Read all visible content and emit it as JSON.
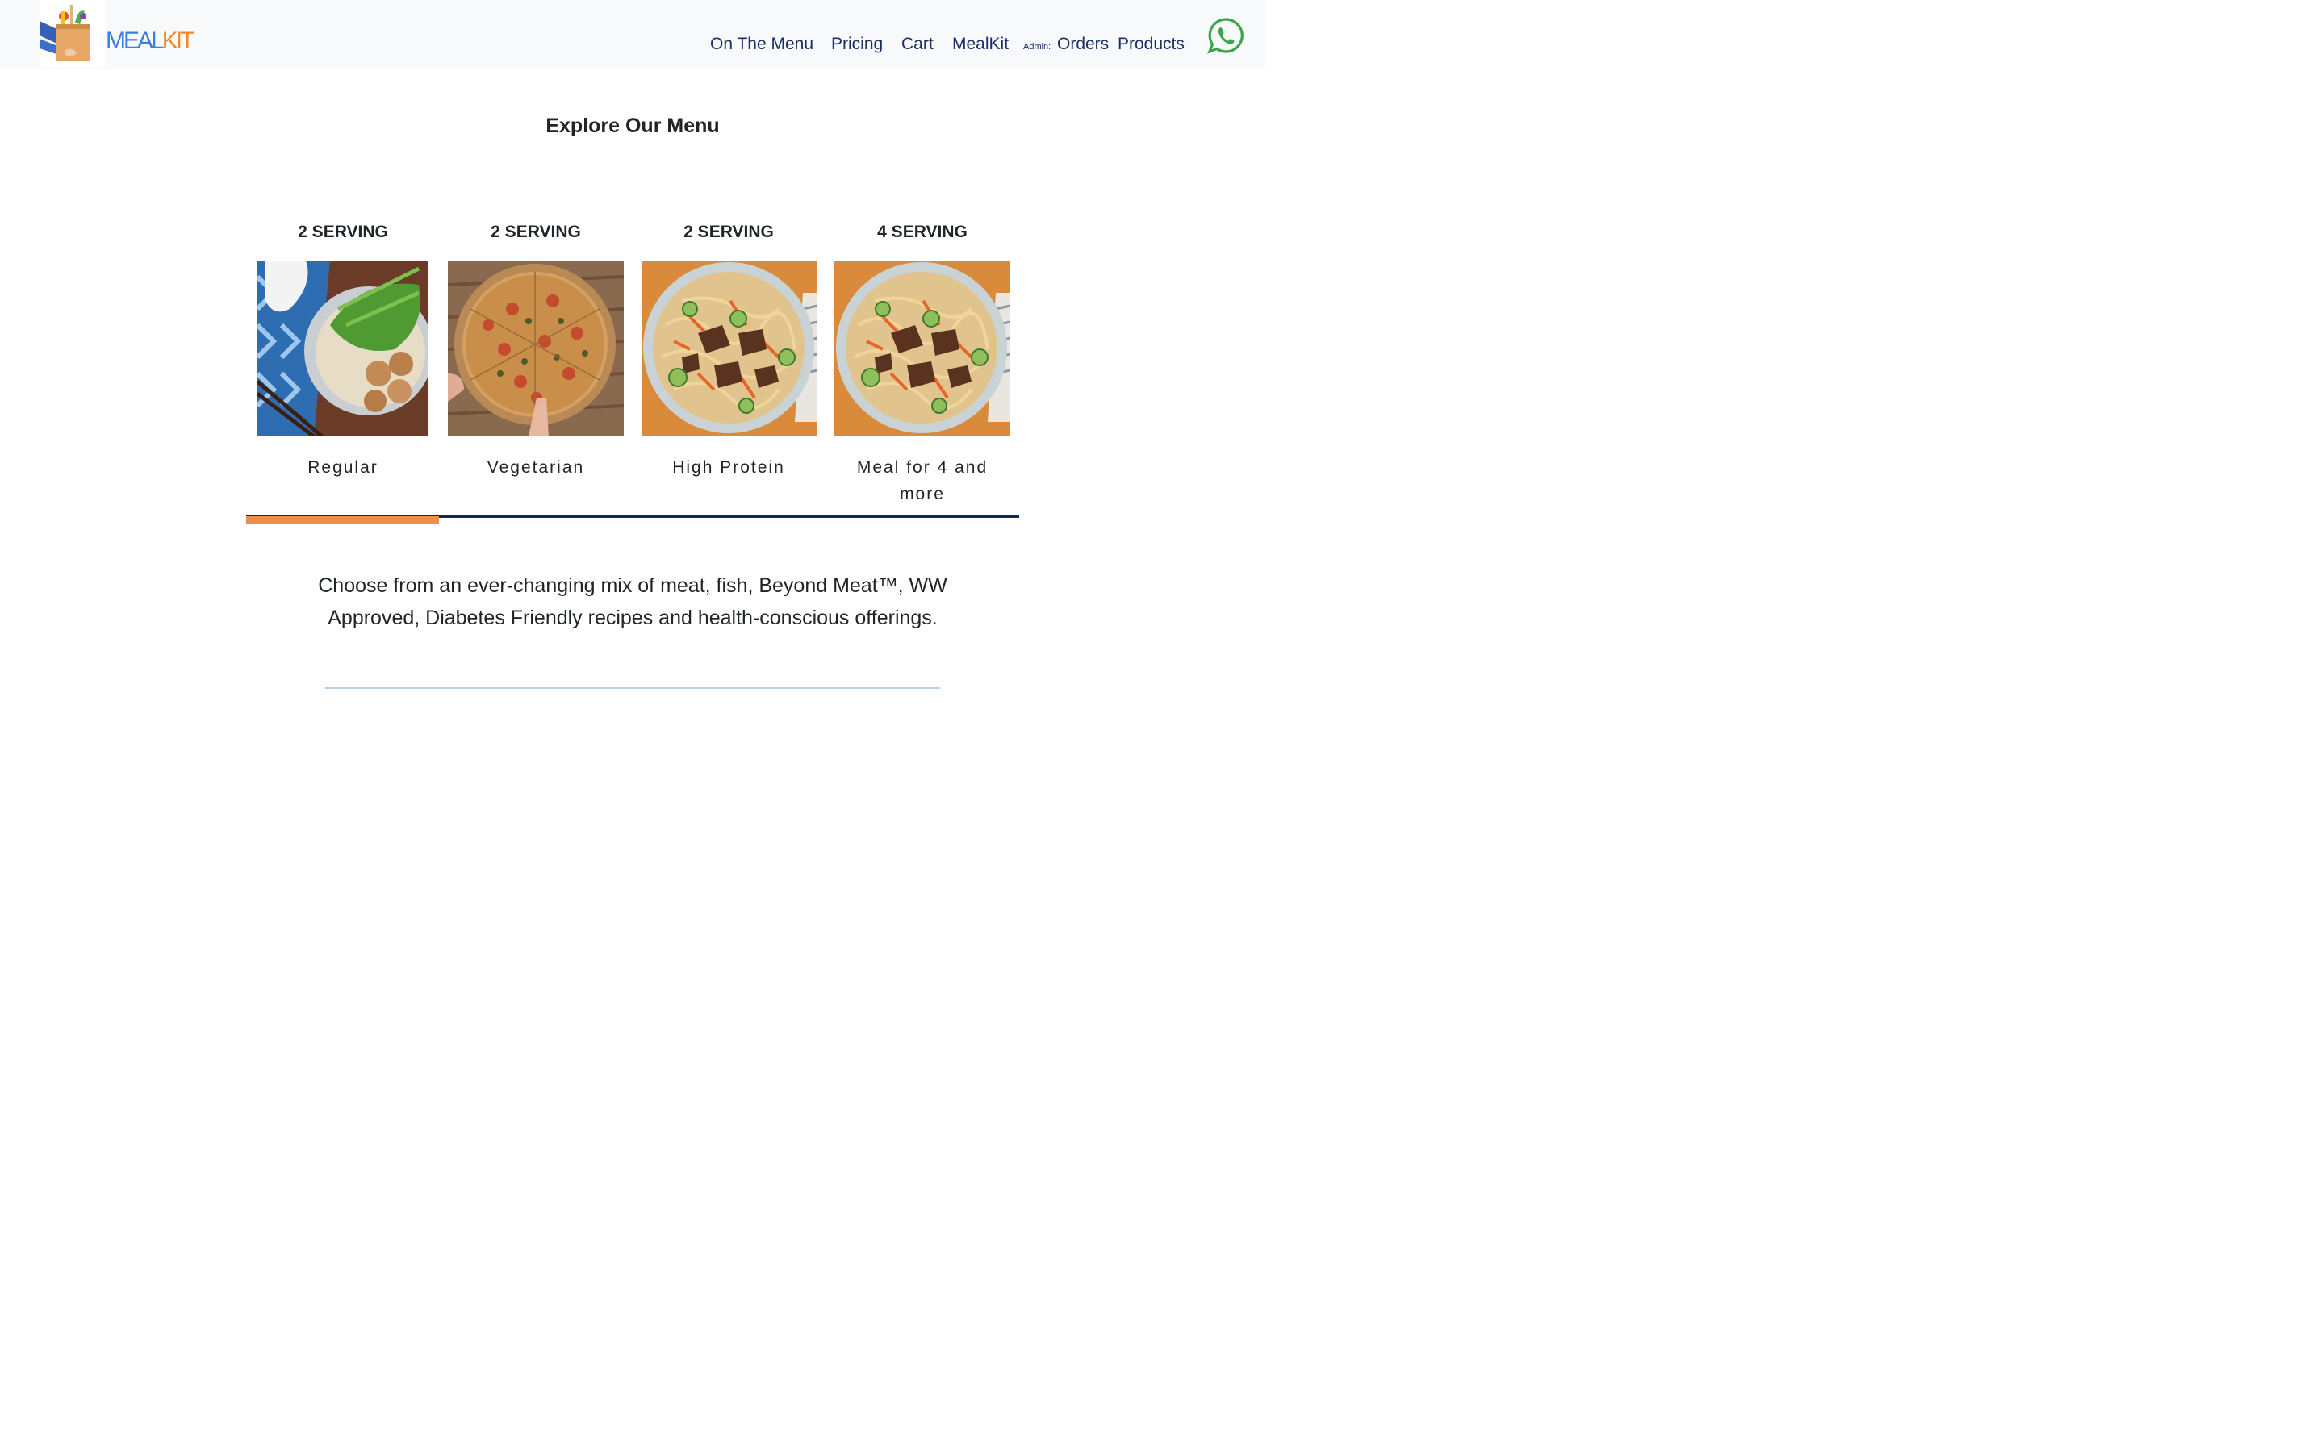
{
  "brand": {
    "logo_text_part1": "MEAL",
    "logo_text_part2": "KIT",
    "logo_icon": "grocery-bag-icon"
  },
  "nav": {
    "items": [
      {
        "label": "On The Menu"
      },
      {
        "label": "Pricing"
      },
      {
        "label": "Cart"
      },
      {
        "label": "MealKit"
      }
    ],
    "admin_label": "Admin:",
    "admin_items": [
      {
        "label": "Orders"
      },
      {
        "label": "Products"
      }
    ],
    "whatsapp_icon": "whatsapp-icon"
  },
  "main": {
    "title": "Explore Our Menu",
    "tabs": [
      {
        "heading": "2 SERVING",
        "label": "Regular",
        "image": "noodle-soup-photo",
        "active": true
      },
      {
        "heading": "2 SERVING",
        "label": "Vegetarian",
        "image": "pizza-photo",
        "active": false
      },
      {
        "heading": "2 SERVING",
        "label": "High Protein",
        "image": "beef-noodle-bowl-photo",
        "active": false
      },
      {
        "heading": "4 SERVING",
        "label": "Meal for 4 and more",
        "image": "beef-noodle-bowl-photo",
        "active": false
      }
    ],
    "description": "Choose from an ever-changing mix of meat, fish, Beyond Meat™, WW Approved, Diabetes Friendly recipes and health-conscious offerings."
  },
  "colors": {
    "nav_text": "#1a2f66",
    "logo_blue": "#3c7ee0",
    "logo_orange": "#f08a2c",
    "active_tab_bar": "#ef8f4b",
    "tab_line": "#13275a",
    "whatsapp_green": "#3aa54b"
  }
}
